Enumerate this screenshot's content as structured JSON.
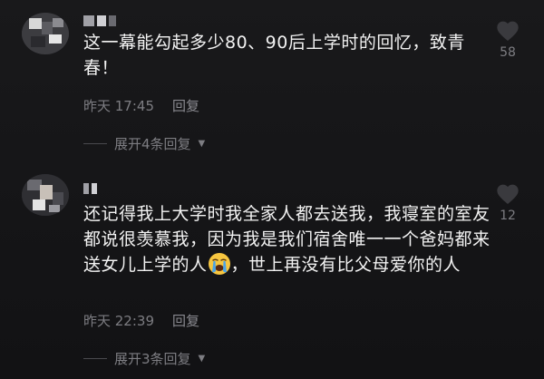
{
  "comments": [
    {
      "text": "这一幕能勾起多少80、90后上学时的回忆，致青春！",
      "time": "昨天 17:45",
      "reply_label": "回复",
      "expand_label": "展开4条回复",
      "likes": "58"
    },
    {
      "text_before_emoji": "还记得我上大学时我全家人都去送我，我寝室的室友都说很羡慕我，因为我是我们宿舍唯一一个爸妈都来送女儿上学的人",
      "emoji": "loudly-crying-face",
      "text_after_emoji": "，世上再没有比父母爱你的人",
      "time": "昨天 22:39",
      "reply_label": "回复",
      "expand_label": "展开3条回复",
      "likes": "12"
    }
  ],
  "colors": {
    "background": "#141416",
    "text": "#f2f2f2",
    "secondary_text": "#7d7d82",
    "heart": "#3a3a3e"
  }
}
